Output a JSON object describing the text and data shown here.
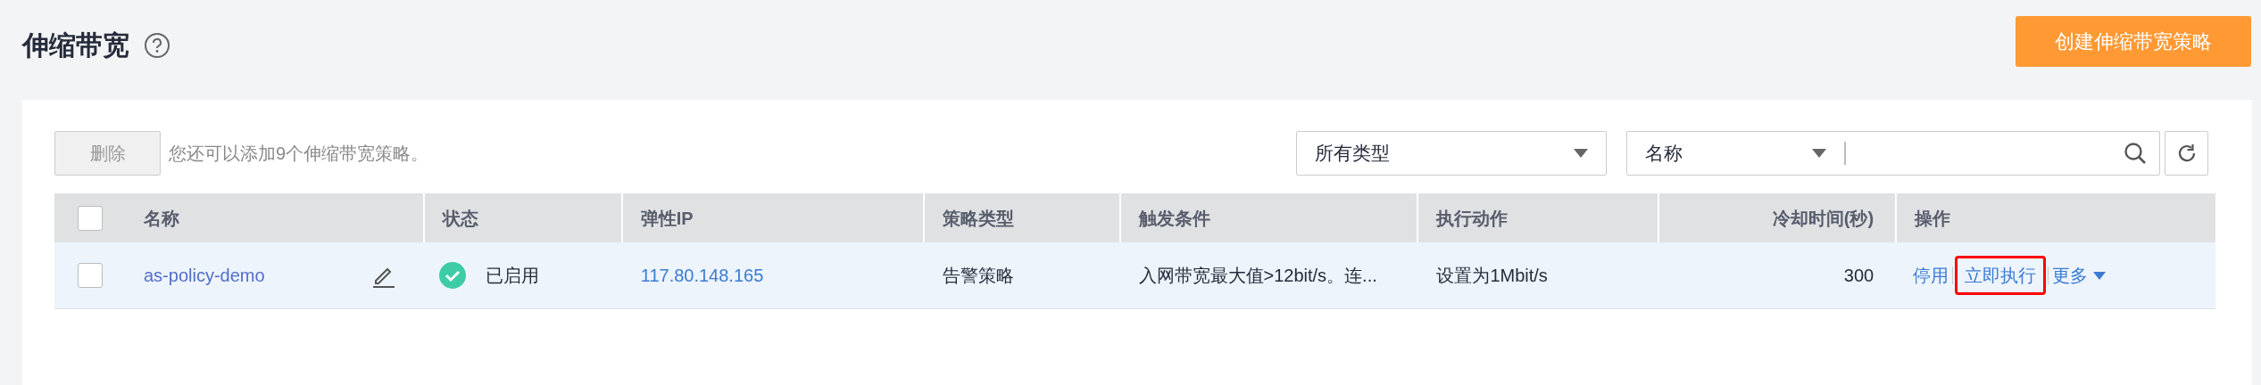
{
  "page": {
    "title": "伸缩带宽",
    "create_button": "创建伸缩带宽策略"
  },
  "toolbar": {
    "delete_button": "删除",
    "delete_disabled": true,
    "hint": "您还可以添加9个伸缩带宽策略。",
    "type_filter": "所有类型",
    "search_field": "名称"
  },
  "table": {
    "all_checked": false,
    "columns": [
      "名称",
      "状态",
      "弹性IP",
      "策略类型",
      "触发条件",
      "执行动作",
      "冷却时间(秒)",
      "操作"
    ],
    "rows": [
      {
        "checked": false,
        "name": "as-policy-demo",
        "status": "已启用",
        "enabled": true,
        "ip": "117.80.148.165",
        "type": "告警策略",
        "trigger": "入网带宽最大值>12bit/s。连...",
        "action": "设置为1Mbit/s",
        "cooldown": "300",
        "operations": [
          {
            "label": "停用",
            "highlighted": false
          },
          {
            "label": "立即执行",
            "highlighted": true
          },
          {
            "label": "更多",
            "highlighted": false,
            "dropdown": true
          }
        ]
      }
    ]
  }
}
